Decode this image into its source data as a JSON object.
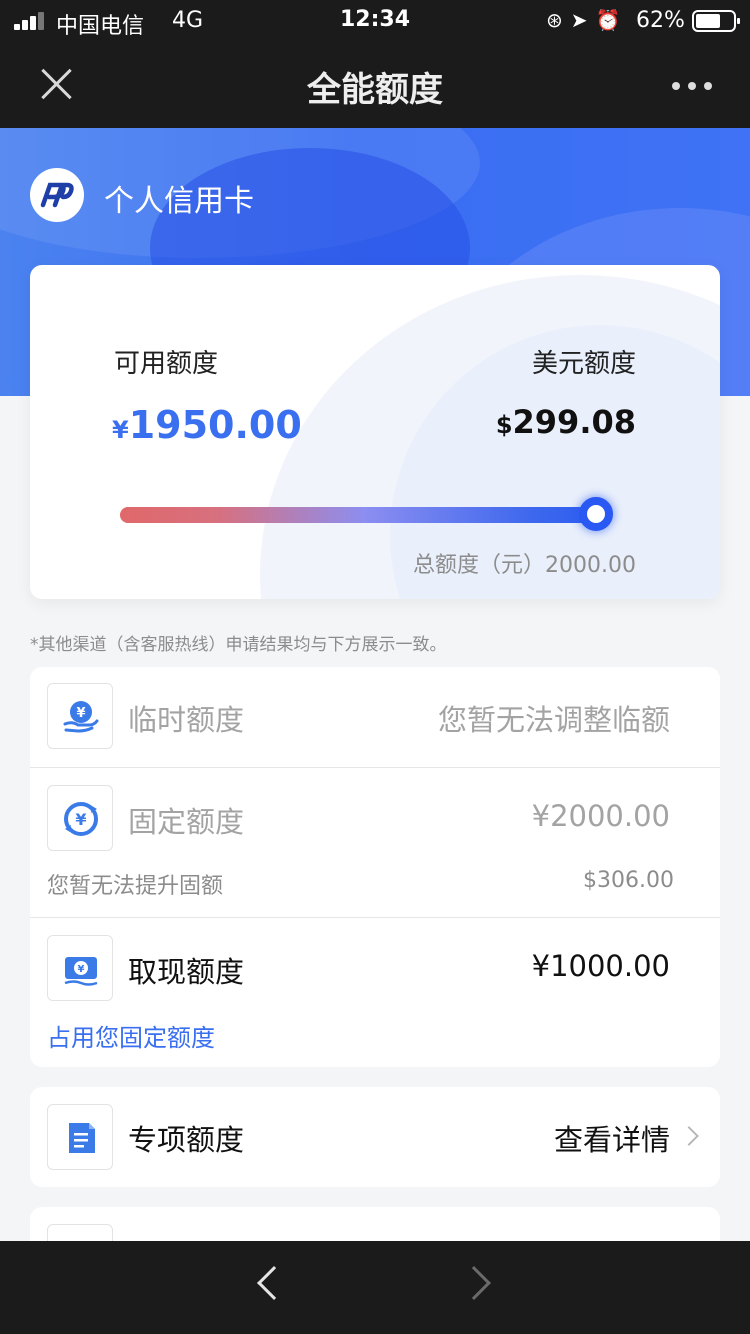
{
  "status_bar": {
    "carrier": "中国电信",
    "network": "4G",
    "time": "12:34",
    "battery": "62%",
    "icons": [
      "orientation-lock-icon",
      "location-icon",
      "alarm-icon"
    ]
  },
  "nav": {
    "title": "全能额度",
    "close_icon": "close-icon",
    "more_icon": "more-icon"
  },
  "header": {
    "bank_name": "个人信用卡",
    "logo_icon": "bank-logo-icon",
    "accent_color": "#3a6ff0"
  },
  "credit": {
    "available_label": "可用额度",
    "available_currency": "¥",
    "available_amount": "1950.00",
    "usd_label": "美元额度",
    "usd_currency": "$",
    "usd_amount": "299.08",
    "total_text": "总额度（元）2000.00",
    "used_fraction": 0.975
  },
  "notice": "*其他渠道（含客服热线）申请结果均与下方展示一致。",
  "limits": {
    "temporary": {
      "title": "临时额度",
      "status": "您暂无法调整临额",
      "icon": "temporary-limit-icon"
    },
    "fixed": {
      "title": "固定额度",
      "amount": "¥2000.00",
      "sub": "您暂无法提升固额",
      "usd_amount": "$306.00",
      "icon": "fixed-limit-icon"
    },
    "cash": {
      "title": "取现额度",
      "amount": "¥1000.00",
      "link": "占用您固定额度",
      "icon": "cash-limit-icon"
    }
  },
  "special": {
    "title": "专项额度",
    "action": "查看详情",
    "icon": "special-limit-icon"
  },
  "bottom_nav": {
    "back_icon": "back-arrow-icon",
    "forward_icon": "forward-arrow-icon"
  }
}
